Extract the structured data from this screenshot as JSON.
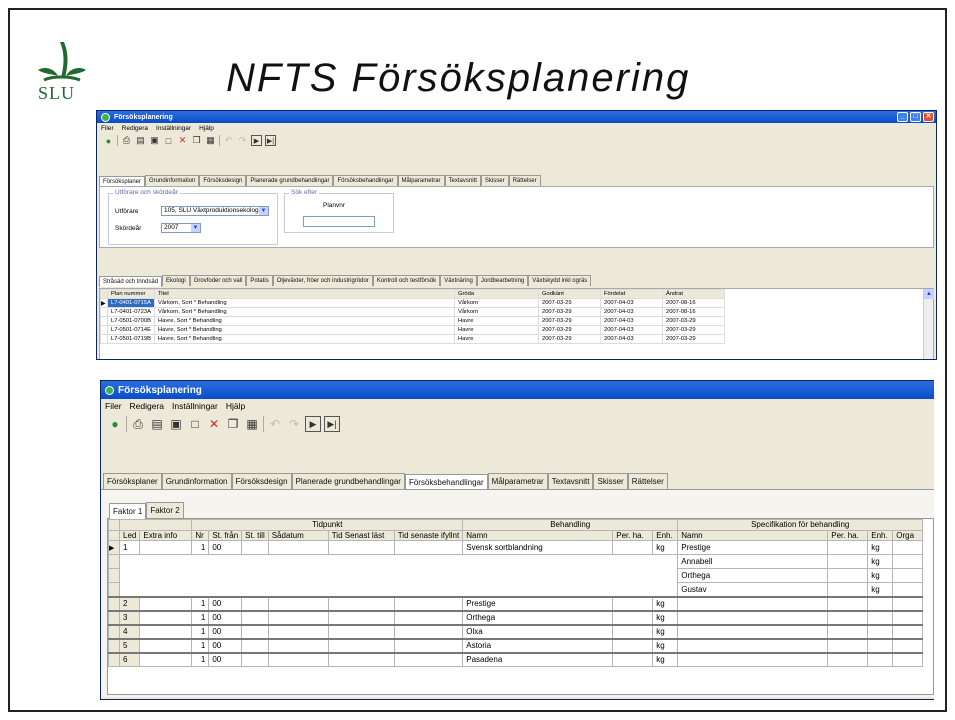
{
  "slide": {
    "title": "NFTS Försöksplanering",
    "logo_text": "SLU",
    "colors": {
      "logo_green": "#1f6b2e",
      "titlebar_blue": "#0a4cc8"
    }
  },
  "win1": {
    "title": "Försöksplanering",
    "menu": [
      "Filer",
      "Redigera",
      "Inställningar",
      "Hjälp"
    ],
    "toolbar_icons": [
      "app-icon",
      "print-icon",
      "print-preview-icon",
      "export-icon",
      "new-icon",
      "delete-icon",
      "copy-icon",
      "paste-icon",
      "undo-icon",
      "redo-icon",
      "next-icon",
      "last-icon"
    ],
    "tabs": [
      "Försöksplaner",
      "Grundinformation",
      "Försöksdesign",
      "Planerade grundbehandlingar",
      "Försöksbehandlingar",
      "Målparametrar",
      "Textavsnitt",
      "Skisser",
      "Rättelser"
    ],
    "active_tab": "Försöksplaner",
    "filters": {
      "group_title": "Utförare och skördeår",
      "utforare_label": "Utförare",
      "utforare_value": "105, SLU Växtproduktionsekologi",
      "skordear_label": "Skördeår",
      "skordear_value": "2007",
      "search_group_title": "Sök efter",
      "search_label": "Planvnr",
      "search_value": ""
    },
    "subtabs": [
      "Stråsäd och trindsäd",
      "Ekologi",
      "Grovfoder och vall",
      "Potatis",
      "Oljeväxter, fröer och industrigrödor",
      "Kontroll och testförsök",
      "Växtnäring",
      "Jordbearbetning",
      "Växtskydd inkl ogräs"
    ],
    "active_subtab": "Stråsäd och trindsäd",
    "columns": [
      "Plan nummer",
      "Titel",
      "Gröda",
      "Godkänt",
      "Fördelat",
      "Ändrat"
    ],
    "rows": [
      [
        "L7-0401-0715A",
        "Vårkorn, Sort * Behandling",
        "Vårkorn",
        "2007-03-29",
        "2007-04-03",
        "2007-08-16"
      ],
      [
        "L7-0401-0723A",
        "Vårkorn, Sort * Behandling",
        "Vårkorn",
        "2007-03-29",
        "2007-04-03",
        "2007-08-16"
      ],
      [
        "L7-0501-0700B",
        "Havre, Sort * Behandling",
        "Havre",
        "2007-03-29",
        "2007-04-03",
        "2007-03-29"
      ],
      [
        "L7-0501-0714E",
        "Havre, Sort * Behandling",
        "Havre",
        "2007-03-29",
        "2007-04-03",
        "2007-03-29"
      ],
      [
        "L7-0501-0719B",
        "Havre, Sort * Behandling",
        "Havre",
        "2007-03-29",
        "2007-04-03",
        "2007-03-29"
      ]
    ]
  },
  "win2": {
    "title": "Försöksplanering",
    "menu": [
      "Filer",
      "Redigera",
      "Inställningar",
      "Hjälp"
    ],
    "tabs": [
      "Försöksplaner",
      "Grundinformation",
      "Försöksdesign",
      "Planerade grundbehandlingar",
      "Försöksbehandlingar",
      "Målparametrar",
      "Textavsnitt",
      "Skisser",
      "Rättelser"
    ],
    "active_tab": "Försöksbehandlingar",
    "factor_tabs": [
      "Faktor 1",
      "Faktor 2"
    ],
    "active_factor": "Faktor 1",
    "group_headers": {
      "tidpunkt": "Tidpunkt",
      "behandling": "Behandling",
      "spec": "Specifikation för behandling"
    },
    "columns": [
      "Led",
      "Extra info",
      "Nr",
      "St. från",
      "St. till",
      "Sådatum",
      "Tid Senast läst",
      "Tid senaste ifyllnt",
      "Namn",
      "Per. ha.",
      "Enh.",
      "Namn",
      "Per. ha.",
      "Enh.",
      "Orga"
    ],
    "rows": [
      {
        "led": "1",
        "nr": "1",
        "st_fran": "00",
        "namn": "Svensk sortblandning",
        "enh": "kg",
        "spec": [
          {
            "namn": "Prestige",
            "enh": "kg"
          },
          {
            "namn": "Annabell",
            "enh": "kg"
          },
          {
            "namn": "Orthega",
            "enh": "kg"
          },
          {
            "namn": "Gustav",
            "enh": "kg"
          }
        ]
      },
      {
        "led": "2",
        "nr": "1",
        "st_fran": "00",
        "namn": "Prestige",
        "enh": "kg"
      },
      {
        "led": "3",
        "nr": "1",
        "st_fran": "00",
        "namn": "Orthega",
        "enh": "kg"
      },
      {
        "led": "4",
        "nr": "1",
        "st_fran": "00",
        "namn": "Olxa",
        "enh": "kg"
      },
      {
        "led": "5",
        "nr": "1",
        "st_fran": "00",
        "namn": "Astoria",
        "enh": "kg"
      },
      {
        "led": "6",
        "nr": "1",
        "st_fran": "00",
        "namn": "Pasadena",
        "enh": "kg"
      }
    ]
  }
}
